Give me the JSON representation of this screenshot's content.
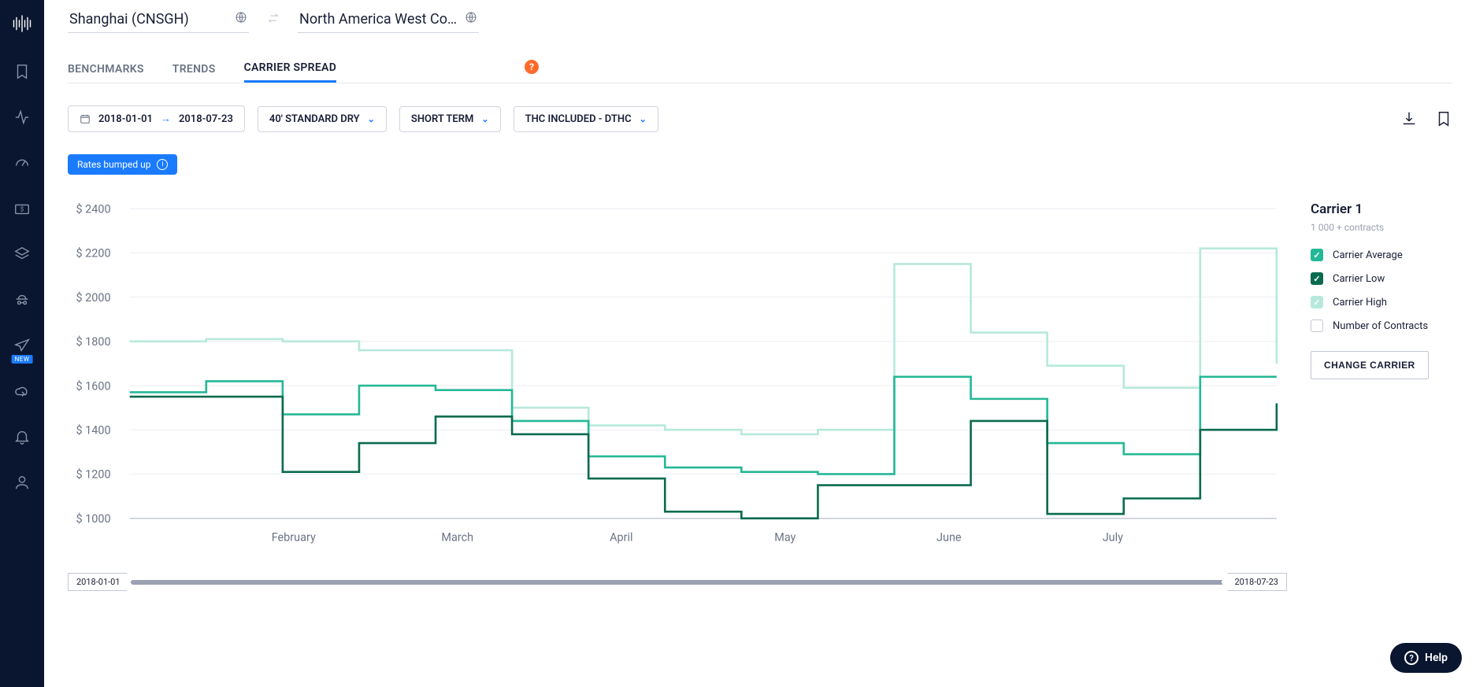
{
  "route": {
    "origin": "Shanghai (CNSGH)",
    "destination": "North America West Co…"
  },
  "tabs": [
    {
      "label": "BENCHMARKS",
      "active": false
    },
    {
      "label": "TRENDS",
      "active": false
    },
    {
      "label": "CARRIER SPREAD",
      "active": true
    }
  ],
  "filters": {
    "date_from": "2018-01-01",
    "date_to": "2018-07-23",
    "container": "40' STANDARD DRY",
    "term": "SHORT TERM",
    "thc": "THC INCLUDED - DTHC"
  },
  "notice": "Rates bumped up",
  "legend": {
    "title": "Carrier 1",
    "subtitle": "1 000 + contracts",
    "items": [
      {
        "label": "Carrier Average",
        "checked": true,
        "color": "#25b896",
        "cls": "avg"
      },
      {
        "label": "Carrier Low",
        "checked": true,
        "color": "#0a6b4f",
        "cls": "low"
      },
      {
        "label": "Carrier High",
        "checked": true,
        "color": "#b6e9db",
        "cls": "high"
      },
      {
        "label": "Number of Contracts",
        "checked": false,
        "color": "#c1c7d4",
        "cls": "unchecked"
      }
    ],
    "change_button": "CHANGE CARRIER"
  },
  "new_badge": "NEW",
  "help_button": "Help",
  "range": {
    "from": "2018-01-01",
    "to": "2018-07-23"
  },
  "chart_data": {
    "type": "line",
    "title": "",
    "xlabel": "",
    "ylabel": "",
    "ylim": [
      1000,
      2400
    ],
    "y_ticks": [
      1000,
      1200,
      1400,
      1600,
      1800,
      2000,
      2200,
      2400
    ],
    "y_tick_labels": [
      "$ 1000",
      "$ 1200",
      "$ 1400",
      "$ 1600",
      "$ 1800",
      "$ 2000",
      "$ 2200",
      "$ 2400"
    ],
    "x_ticks": [
      "February",
      "March",
      "April",
      "May",
      "June",
      "July"
    ],
    "x": [
      0,
      2,
      4,
      6,
      8,
      10,
      12,
      14,
      16,
      18,
      20,
      22,
      24,
      26,
      28
    ],
    "series": [
      {
        "name": "Carrier High",
        "color": "#b6e9db",
        "values": [
          1800,
          1810,
          1800,
          1760,
          1760,
          1500,
          1420,
          1400,
          1380,
          1400,
          2150,
          1840,
          1690,
          1590,
          2220,
          1700
        ]
      },
      {
        "name": "Carrier Average",
        "color": "#25b896",
        "values": [
          1570,
          1620,
          1470,
          1600,
          1580,
          1440,
          1280,
          1230,
          1210,
          1200,
          1640,
          1540,
          1340,
          1290,
          1640,
          1640
        ]
      },
      {
        "name": "Carrier Low",
        "color": "#0a6b4f",
        "values": [
          1550,
          1550,
          1210,
          1340,
          1460,
          1380,
          1180,
          1030,
          1000,
          1150,
          1150,
          1440,
          1020,
          1090,
          1400,
          1520
        ]
      }
    ]
  }
}
